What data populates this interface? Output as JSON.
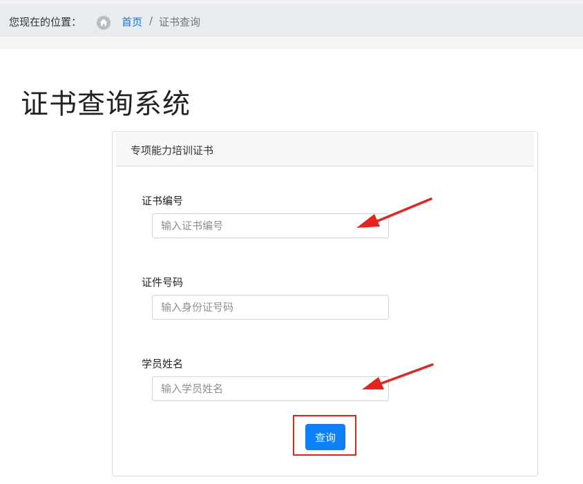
{
  "breadcrumb": {
    "prefix": "您现在的位置：",
    "home": "首页",
    "separator": "/",
    "current": "证书查询"
  },
  "page": {
    "title": "证书查询系统"
  },
  "card": {
    "header": "专项能力培训证书"
  },
  "form": {
    "cert_no": {
      "label": "证书编号",
      "placeholder": "输入证书编号",
      "value": ""
    },
    "id_no": {
      "label": "证件号码",
      "placeholder": "输入身份证号码",
      "value": ""
    },
    "name": {
      "label": "学员姓名",
      "placeholder": "输入学员姓名",
      "value": ""
    },
    "submit_label": "查询"
  },
  "icons": {
    "home": "home-icon",
    "arrow": "red-arrow-annotation"
  },
  "colors": {
    "link": "#1a73e8",
    "primary_button": "#0d7ff7",
    "annotation": "#e8231c"
  }
}
